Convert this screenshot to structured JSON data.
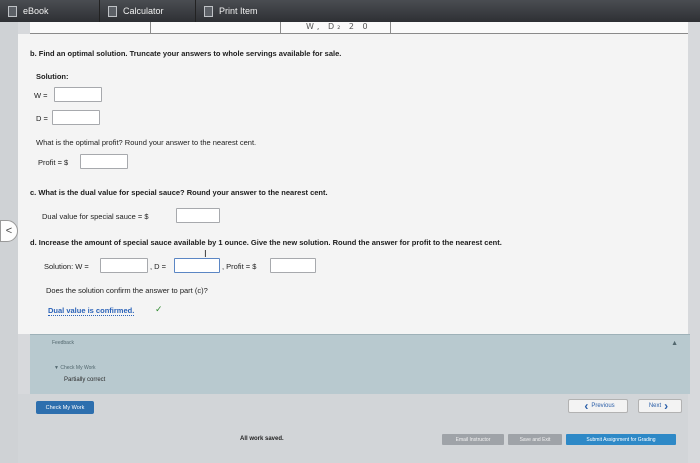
{
  "toolbar": {
    "tabs": [
      {
        "label": "eBook"
      },
      {
        "label": "Calculator"
      },
      {
        "label": "Print Item"
      }
    ]
  },
  "table_remnant": {
    "values": "W, D₂ 2 0"
  },
  "part_b": {
    "question": "b. Find an optimal solution. Truncate your answers to whole servings available for sale.",
    "solution_label": "Solution:",
    "w_label": "W =",
    "w_value": "",
    "d_label": "D =",
    "d_value": "",
    "profit_question": "What is the optimal profit? Round your answer to the nearest cent.",
    "profit_label": "Profit = $",
    "profit_value": ""
  },
  "part_c": {
    "question": "c. What is the dual value for special sauce? Round your answer to the nearest cent.",
    "dual_label": "Dual value for special sauce = $",
    "dual_value": ""
  },
  "part_d": {
    "question": "d. Increase the amount of special sauce available by 1 ounce. Give the new solution. Round the answer for profit to the nearest cent.",
    "solution_label": "Solution: W =",
    "w_value": "",
    "d_label": ", D =",
    "d_value": "",
    "profit_label": ", Profit = $",
    "profit_value": "",
    "confirm_question": "Does the solution confirm the answer to part (c)?",
    "confirm_selected": "Dual value is confirmed.",
    "check_mark": "✓"
  },
  "feedback": {
    "title": "Feedback",
    "check_my_work": "▼ Check My Work",
    "status": "Partially correct"
  },
  "footer": {
    "check_work": "Check My Work",
    "previous": "Previous",
    "next": "Next",
    "saved": "All work saved.",
    "email": "Email Instructor",
    "save_exit": "Save and Exit",
    "submit": "Submit Assignment for Grading"
  },
  "side_nav": {
    "icon": "<"
  }
}
